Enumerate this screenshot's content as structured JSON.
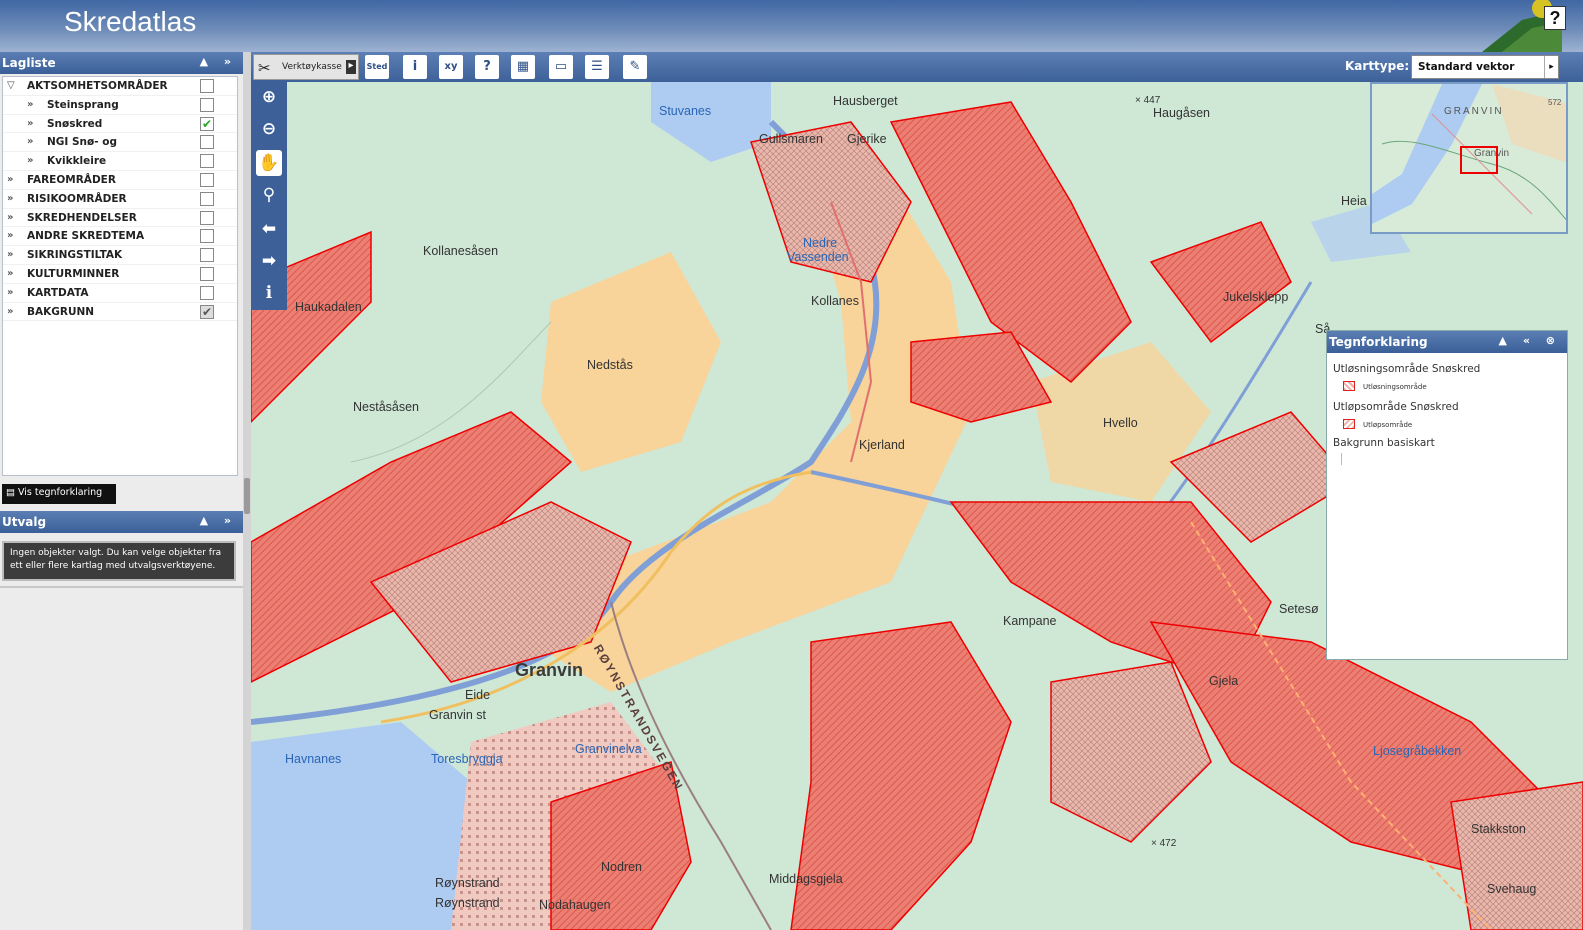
{
  "app": {
    "title": "Skredatlas",
    "help": "?"
  },
  "layers_panel": {
    "title": "Lagliste",
    "controls": "▲ »",
    "items": [
      {
        "label": "AKTSOMHETSOMRÅDER",
        "checked": false,
        "level": 0,
        "expanded": true
      },
      {
        "label": "Steinsprang",
        "checked": false,
        "level": 1
      },
      {
        "label": "Snøskred",
        "checked": true,
        "level": 1
      },
      {
        "label": "NGI Snø- og",
        "checked": false,
        "level": 1
      },
      {
        "label": "Kvikkleire",
        "checked": false,
        "level": 1
      },
      {
        "label": "FAREOMRÅDER",
        "checked": false,
        "level": 0
      },
      {
        "label": "RISIKOOMRÅDER",
        "checked": false,
        "level": 0
      },
      {
        "label": "SKREDHENDELSER",
        "checked": false,
        "level": 0
      },
      {
        "label": "ANDRE SKREDTEMA",
        "checked": false,
        "level": 0
      },
      {
        "label": "SIKRINGSTILTAK",
        "checked": false,
        "level": 0
      },
      {
        "label": "KULTURMINNER",
        "checked": false,
        "level": 0
      },
      {
        "label": "KARTDATA",
        "checked": false,
        "level": 0
      },
      {
        "label": "BAKGRUNN",
        "checked": true,
        "level": 0
      }
    ],
    "legend_button": "Vis tegnforklaring"
  },
  "selection_panel": {
    "title": "Utvalg",
    "controls": "▲ »",
    "message": "Ingen objekter valgt. Du kan velge objekter fra ett eller flere kartlag med utvalgsverktøyene."
  },
  "toolbar": {
    "toolbox_label": "Verktøykasse",
    "place_icon_text": "Sted",
    "map_type_label": "Karttype:",
    "map_type_value": "Standard vektor"
  },
  "legend_panel": {
    "title": "Tegnforklaring",
    "sections": [
      {
        "heading": "Utløsningsområde Snøskred",
        "item": "Utløsningsområde"
      },
      {
        "heading": "Utløpsområde Snøskred",
        "item": "Utløpsområde"
      },
      {
        "heading": "Bakgrunn basiskart",
        "item": ""
      }
    ]
  },
  "map": {
    "labels": {
      "stuvanes": "Stuvanes",
      "hausberget": "Hausberget",
      "spot447": "× 447",
      "haugasen": "Haugåsen",
      "gullsmaren": "Gullsmaren",
      "gjerike": "Gjerike",
      "kollanesasen": "Kollanesåsen",
      "nedre": "Nedre",
      "vassenden": "Vassenden",
      "haukadalen": "Haukadalen",
      "kollanes": "Kollanes",
      "jukelsklepp": "Jukelsklepp",
      "nedstas": "Nedstås",
      "nestasasen": "Neståsåsen",
      "kjerland": "Kjerland",
      "hvello": "Hvello",
      "royynstrand_road": "RØYNSTRANDSVEGEN",
      "kampane": "Kampane",
      "granvin": "Granvin",
      "eide": "Eide",
      "granvin_st": "Granvin st",
      "gjela": "Gjela",
      "havnanes": "Havnanes",
      "toresbryggja": "Toresbryggja",
      "granvinelva": "Granvinelva",
      "lonsegrabekken": "Ljosegråbekken",
      "spot472": "× 472",
      "stakkston": "Stakkston",
      "roynstrand": "Røynstrand",
      "royntrand2": "Røynstrand",
      "nodrd": "Nodren",
      "middagsgjela": "Middagsgjela",
      "svehaug": "Svehaug",
      "nodahaugen": "Nodahaugen",
      "heia": "Heia",
      "seteso": "Setesø",
      "sa": "Så"
    },
    "overview": {
      "top_label": "GRANVIN",
      "box_label": "Granvin",
      "spot": "572"
    }
  },
  "colors": {
    "header": "#4a6fa8",
    "avalanche_release": "#e8574a",
    "avalanche_runout": "#f2a99f",
    "forest": "#cfe8d6",
    "water": "#aecbf2",
    "settlement": "#f8d39a"
  }
}
